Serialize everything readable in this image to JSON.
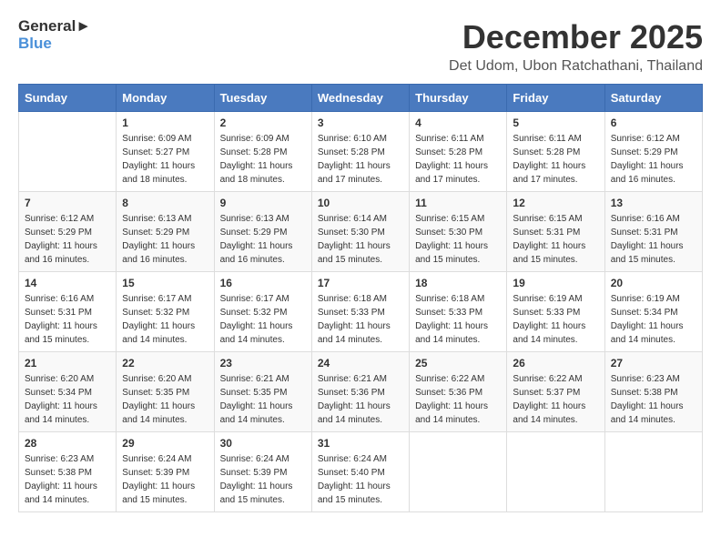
{
  "header": {
    "logo_general": "General",
    "logo_blue": "Blue",
    "month": "December 2025",
    "location": "Det Udom, Ubon Ratchathani, Thailand"
  },
  "weekdays": [
    "Sunday",
    "Monday",
    "Tuesday",
    "Wednesday",
    "Thursday",
    "Friday",
    "Saturday"
  ],
  "weeks": [
    [
      {
        "day": "",
        "sunrise": "",
        "sunset": "",
        "daylight": ""
      },
      {
        "day": "1",
        "sunrise": "Sunrise: 6:09 AM",
        "sunset": "Sunset: 5:27 PM",
        "daylight": "Daylight: 11 hours and 18 minutes."
      },
      {
        "day": "2",
        "sunrise": "Sunrise: 6:09 AM",
        "sunset": "Sunset: 5:28 PM",
        "daylight": "Daylight: 11 hours and 18 minutes."
      },
      {
        "day": "3",
        "sunrise": "Sunrise: 6:10 AM",
        "sunset": "Sunset: 5:28 PM",
        "daylight": "Daylight: 11 hours and 17 minutes."
      },
      {
        "day": "4",
        "sunrise": "Sunrise: 6:11 AM",
        "sunset": "Sunset: 5:28 PM",
        "daylight": "Daylight: 11 hours and 17 minutes."
      },
      {
        "day": "5",
        "sunrise": "Sunrise: 6:11 AM",
        "sunset": "Sunset: 5:28 PM",
        "daylight": "Daylight: 11 hours and 17 minutes."
      },
      {
        "day": "6",
        "sunrise": "Sunrise: 6:12 AM",
        "sunset": "Sunset: 5:29 PM",
        "daylight": "Daylight: 11 hours and 16 minutes."
      }
    ],
    [
      {
        "day": "7",
        "sunrise": "Sunrise: 6:12 AM",
        "sunset": "Sunset: 5:29 PM",
        "daylight": "Daylight: 11 hours and 16 minutes."
      },
      {
        "day": "8",
        "sunrise": "Sunrise: 6:13 AM",
        "sunset": "Sunset: 5:29 PM",
        "daylight": "Daylight: 11 hours and 16 minutes."
      },
      {
        "day": "9",
        "sunrise": "Sunrise: 6:13 AM",
        "sunset": "Sunset: 5:29 PM",
        "daylight": "Daylight: 11 hours and 16 minutes."
      },
      {
        "day": "10",
        "sunrise": "Sunrise: 6:14 AM",
        "sunset": "Sunset: 5:30 PM",
        "daylight": "Daylight: 11 hours and 15 minutes."
      },
      {
        "day": "11",
        "sunrise": "Sunrise: 6:15 AM",
        "sunset": "Sunset: 5:30 PM",
        "daylight": "Daylight: 11 hours and 15 minutes."
      },
      {
        "day": "12",
        "sunrise": "Sunrise: 6:15 AM",
        "sunset": "Sunset: 5:31 PM",
        "daylight": "Daylight: 11 hours and 15 minutes."
      },
      {
        "day": "13",
        "sunrise": "Sunrise: 6:16 AM",
        "sunset": "Sunset: 5:31 PM",
        "daylight": "Daylight: 11 hours and 15 minutes."
      }
    ],
    [
      {
        "day": "14",
        "sunrise": "Sunrise: 6:16 AM",
        "sunset": "Sunset: 5:31 PM",
        "daylight": "Daylight: 11 hours and 15 minutes."
      },
      {
        "day": "15",
        "sunrise": "Sunrise: 6:17 AM",
        "sunset": "Sunset: 5:32 PM",
        "daylight": "Daylight: 11 hours and 14 minutes."
      },
      {
        "day": "16",
        "sunrise": "Sunrise: 6:17 AM",
        "sunset": "Sunset: 5:32 PM",
        "daylight": "Daylight: 11 hours and 14 minutes."
      },
      {
        "day": "17",
        "sunrise": "Sunrise: 6:18 AM",
        "sunset": "Sunset: 5:33 PM",
        "daylight": "Daylight: 11 hours and 14 minutes."
      },
      {
        "day": "18",
        "sunrise": "Sunrise: 6:18 AM",
        "sunset": "Sunset: 5:33 PM",
        "daylight": "Daylight: 11 hours and 14 minutes."
      },
      {
        "day": "19",
        "sunrise": "Sunrise: 6:19 AM",
        "sunset": "Sunset: 5:33 PM",
        "daylight": "Daylight: 11 hours and 14 minutes."
      },
      {
        "day": "20",
        "sunrise": "Sunrise: 6:19 AM",
        "sunset": "Sunset: 5:34 PM",
        "daylight": "Daylight: 11 hours and 14 minutes."
      }
    ],
    [
      {
        "day": "21",
        "sunrise": "Sunrise: 6:20 AM",
        "sunset": "Sunset: 5:34 PM",
        "daylight": "Daylight: 11 hours and 14 minutes."
      },
      {
        "day": "22",
        "sunrise": "Sunrise: 6:20 AM",
        "sunset": "Sunset: 5:35 PM",
        "daylight": "Daylight: 11 hours and 14 minutes."
      },
      {
        "day": "23",
        "sunrise": "Sunrise: 6:21 AM",
        "sunset": "Sunset: 5:35 PM",
        "daylight": "Daylight: 11 hours and 14 minutes."
      },
      {
        "day": "24",
        "sunrise": "Sunrise: 6:21 AM",
        "sunset": "Sunset: 5:36 PM",
        "daylight": "Daylight: 11 hours and 14 minutes."
      },
      {
        "day": "25",
        "sunrise": "Sunrise: 6:22 AM",
        "sunset": "Sunset: 5:36 PM",
        "daylight": "Daylight: 11 hours and 14 minutes."
      },
      {
        "day": "26",
        "sunrise": "Sunrise: 6:22 AM",
        "sunset": "Sunset: 5:37 PM",
        "daylight": "Daylight: 11 hours and 14 minutes."
      },
      {
        "day": "27",
        "sunrise": "Sunrise: 6:23 AM",
        "sunset": "Sunset: 5:38 PM",
        "daylight": "Daylight: 11 hours and 14 minutes."
      }
    ],
    [
      {
        "day": "28",
        "sunrise": "Sunrise: 6:23 AM",
        "sunset": "Sunset: 5:38 PM",
        "daylight": "Daylight: 11 hours and 14 minutes."
      },
      {
        "day": "29",
        "sunrise": "Sunrise: 6:24 AM",
        "sunset": "Sunset: 5:39 PM",
        "daylight": "Daylight: 11 hours and 15 minutes."
      },
      {
        "day": "30",
        "sunrise": "Sunrise: 6:24 AM",
        "sunset": "Sunset: 5:39 PM",
        "daylight": "Daylight: 11 hours and 15 minutes."
      },
      {
        "day": "31",
        "sunrise": "Sunrise: 6:24 AM",
        "sunset": "Sunset: 5:40 PM",
        "daylight": "Daylight: 11 hours and 15 minutes."
      },
      {
        "day": "",
        "sunrise": "",
        "sunset": "",
        "daylight": ""
      },
      {
        "day": "",
        "sunrise": "",
        "sunset": "",
        "daylight": ""
      },
      {
        "day": "",
        "sunrise": "",
        "sunset": "",
        "daylight": ""
      }
    ]
  ]
}
